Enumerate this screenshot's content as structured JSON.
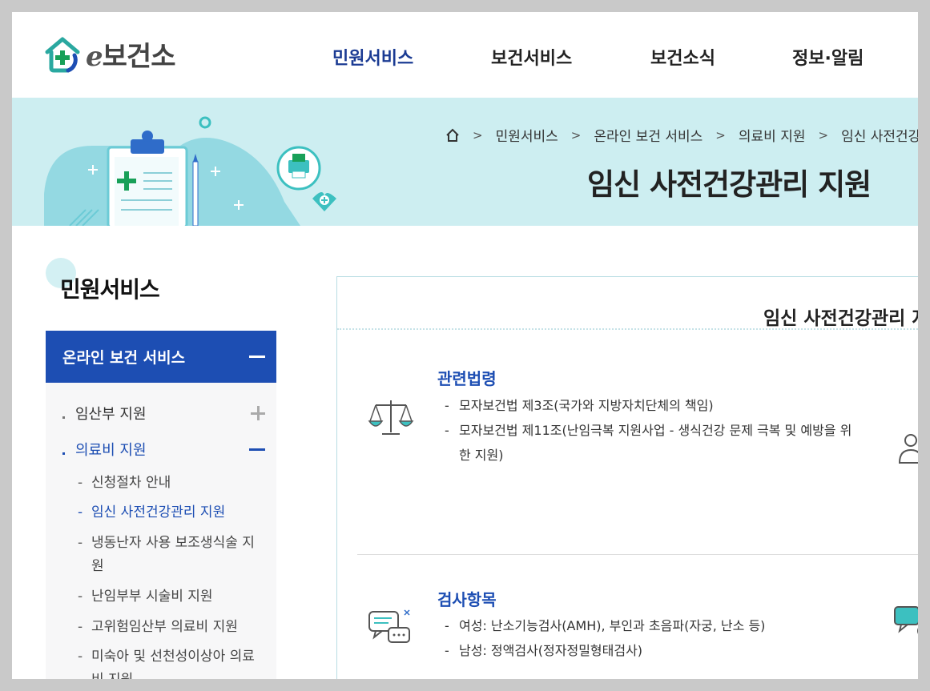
{
  "header": {
    "logo_text": "보건소",
    "logo_prefix": "e",
    "nav": [
      "민원서비스",
      "보건서비스",
      "보건소식",
      "정보·알림"
    ]
  },
  "banner": {
    "breadcrumb": [
      "민원서비스",
      "온라인 보건 서비스",
      "의료비 지원",
      "임신 사전건강관리 지원"
    ],
    "title": "임신 사전건강관리 지원"
  },
  "sidebar": {
    "title": "민원서비스",
    "section": "온라인 보건 서비스",
    "items": [
      {
        "label": "임산부 지원"
      },
      {
        "label": "의료비 지원"
      }
    ],
    "subitems": [
      {
        "label": "신청절차 안내"
      },
      {
        "label": "임신 사전건강관리 지원"
      },
      {
        "label": "냉동난자 사용 보조생식술 지원"
      },
      {
        "label": "난임부부 시술비 지원"
      },
      {
        "label": "고위험임산부 의료비 지원"
      },
      {
        "label": "미숙아 및 선천성이상아 의료비 지원"
      }
    ]
  },
  "content": {
    "title": "임신 사전건강관리 지원",
    "sections": [
      {
        "title": "관련법령",
        "items": [
          "모자보건법 제3조(국가와 지방자치단체의 책임)",
          "모자보건법 제11조(난임극복 지원사업 - 생식건강 문제 극복 및 예방을 위한 지원)"
        ]
      },
      {
        "title": "검사항목",
        "items": [
          "여성: 난소기능검사(AMH), 부인과 초음파(자궁, 난소 등)",
          "남성: 정액검사(정자정밀형태검사)"
        ]
      }
    ]
  },
  "colors": {
    "brand_blue": "#1d4eb3",
    "nav_active": "#1b3b93",
    "banner_bg": "#cdeef1",
    "teal": "#3cc0c0",
    "green": "#18a058"
  }
}
